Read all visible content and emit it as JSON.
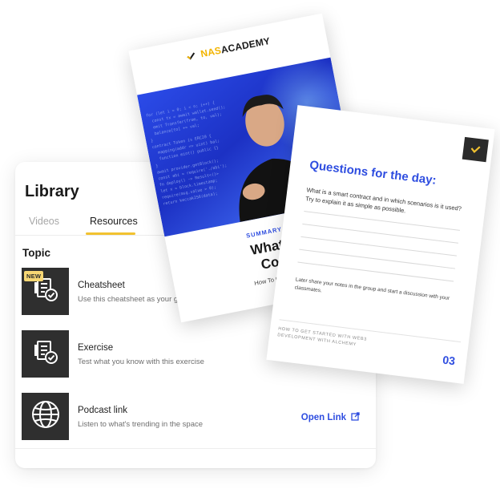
{
  "library": {
    "title": "Library",
    "tabs": [
      {
        "label": "Videos",
        "active": false
      },
      {
        "label": "Resources",
        "active": true
      }
    ],
    "section_title": "Topic",
    "items": [
      {
        "title": "Cheatsheet",
        "description": "Use this cheatsheet as your guide",
        "badge": "NEW",
        "icon": "document-check-icon"
      },
      {
        "title": "Exercise",
        "description": "Test what you know with this exercise",
        "icon": "document-check-icon"
      },
      {
        "title": "Podcast link",
        "description": "Listen to what's trending in the space",
        "icon": "globe-icon",
        "action_label": "Open Link",
        "action_icon": "external-link-icon"
      }
    ]
  },
  "summary_card": {
    "brand_part1": "NAS",
    "brand_part2": "ACADEMY",
    "label": "SUMMARY",
    "title_line1": "What",
    "title_line2": "Co",
    "subtitle": "How To Get St"
  },
  "questions_card": {
    "title": "Questions for the day:",
    "question": "What is a smart contract and in which scenarios is it used? Try to explain it as simple as possible.",
    "note": "Later share your notes in the group and start a discussion with your classmates.",
    "footer": "HOW TO GET STARTED WITH WEB3 DEVELOPMENT WITH ALCHEMY",
    "page_number": "03"
  },
  "colors": {
    "accent_blue": "#2e4de0",
    "accent_yellow": "#f2c230",
    "badge_yellow": "#f7d774",
    "thumb_dark": "#2f2f2f"
  }
}
